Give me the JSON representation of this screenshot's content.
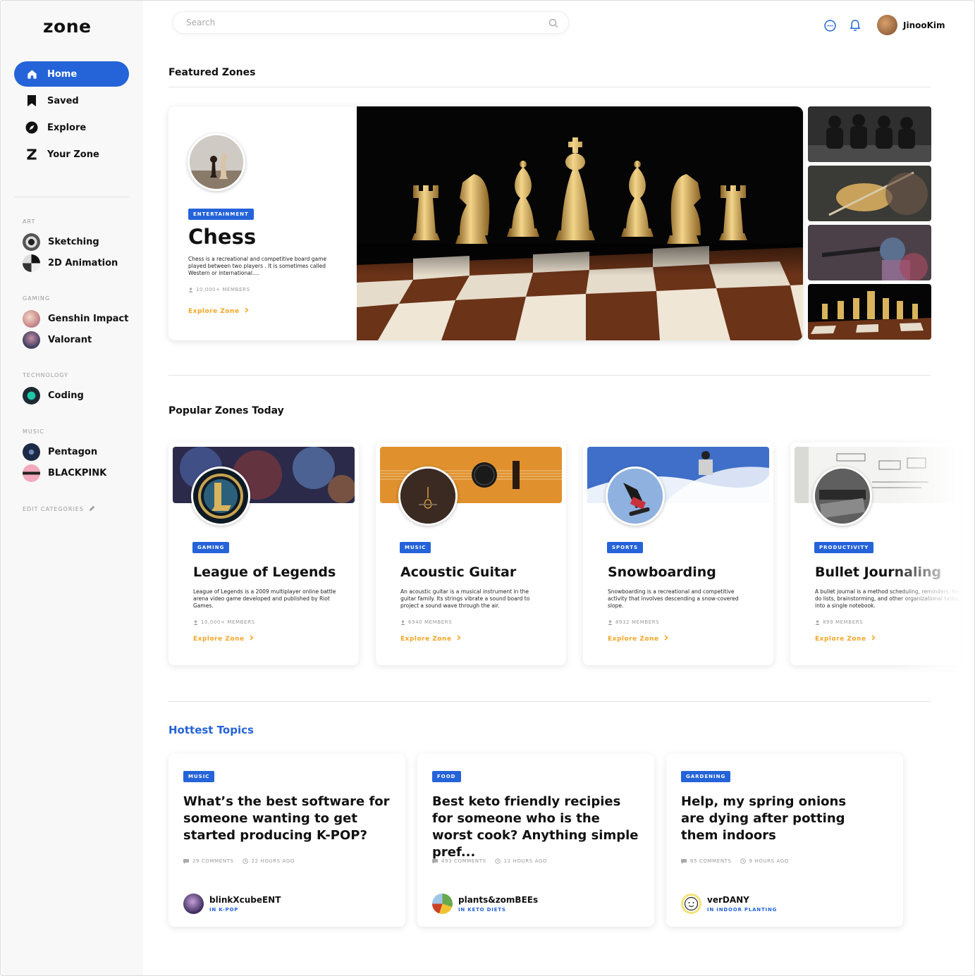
{
  "app": {
    "logo": "zone"
  },
  "search": {
    "placeholder": "Search"
  },
  "user": {
    "name": "JinooKim"
  },
  "nav": [
    {
      "label": "Home",
      "icon": "home-icon",
      "active": true
    },
    {
      "label": "Saved",
      "icon": "bookmark-icon"
    },
    {
      "label": "Explore",
      "icon": "compass-icon"
    },
    {
      "label": "Your Zone",
      "icon": "zone-z-icon"
    }
  ],
  "categories": [
    {
      "title": "ART",
      "items": [
        "Sketching",
        "2D Animation"
      ]
    },
    {
      "title": "GAMING",
      "items": [
        "Genshin Impact",
        "Valorant"
      ]
    },
    {
      "title": "TECHNOLOGY",
      "items": [
        "Coding"
      ]
    },
    {
      "title": "MUSIC",
      "items": [
        "Pentagon",
        "BLACKPINK"
      ]
    }
  ],
  "edit_categories": "EDIT CATEGORIES",
  "featured": {
    "section_title": "Featured Zones",
    "badge": "ENTERTAINMENT",
    "title": "Chess",
    "description": "Chess is a recreational and competitive board game played between two players . It is sometimes called Western or international....",
    "members": "10,000+ MEMBERS",
    "explore": "Explore Zone"
  },
  "popular": {
    "section_title": "Popular Zones Today",
    "cards": [
      {
        "badge": "GAMING",
        "title": "League of Legends",
        "description": "League of Legends is a 2009 multiplayer online battle arena video game developed and published by Riot Games.",
        "members": "10,000+ MEMBERS",
        "explore": "Explore Zone"
      },
      {
        "badge": "MUSIC",
        "title": "Acoustic Guitar",
        "description": "An acoustic guitar is a musical instrument in the guitar family. Its strings vibrate a sound board to project a sound wave through the air.",
        "members": "6940 MEMBERS",
        "explore": "Explore Zone"
      },
      {
        "badge": "SPORTS",
        "title": "Snowboarding",
        "description": "Snowboarding is a recreational and competitive activity that involves descending a snow-covered slope.",
        "members": "8932 MEMBERS",
        "explore": "Explore Zone"
      },
      {
        "badge": "PRODUCTIVITY",
        "title": "Bullet Journaling",
        "description": "A bullet journal is a method scheduling, reminders, to-do lists, brainstorming, and other organizational tasks into a single notebook.",
        "members": "899 MEMBERS",
        "explore": "Explore Zone"
      }
    ]
  },
  "hottest": {
    "section_title": "Hottest Topics",
    "cards": [
      {
        "badge": "MUSIC",
        "title": "What’s the best software for someone wanting to get started producing K-POP?",
        "comments": "29 COMMENTS",
        "time": "22 HOURS AGO",
        "user": "blinkXcubeENT",
        "zone": "IN K-POP"
      },
      {
        "badge": "FOOD",
        "title": "Best keto friendly recipies for someone who is the worst cook? Anything simple pref...",
        "comments": "493 COMMENTS",
        "time": "12 HOURS AGO",
        "user": "plants&zomBEEs",
        "zone": "IN KETO DIETS"
      },
      {
        "badge": "GARDENING",
        "title": "Help, my spring onions are dying after potting them indoors",
        "comments": "65 COMMENTS",
        "time": "9 HOURS AGO",
        "user": "verDANY",
        "zone": "IN INDOOR PLANTING"
      }
    ]
  },
  "colors": {
    "accent": "#2563d9",
    "explore": "#f5a524"
  }
}
